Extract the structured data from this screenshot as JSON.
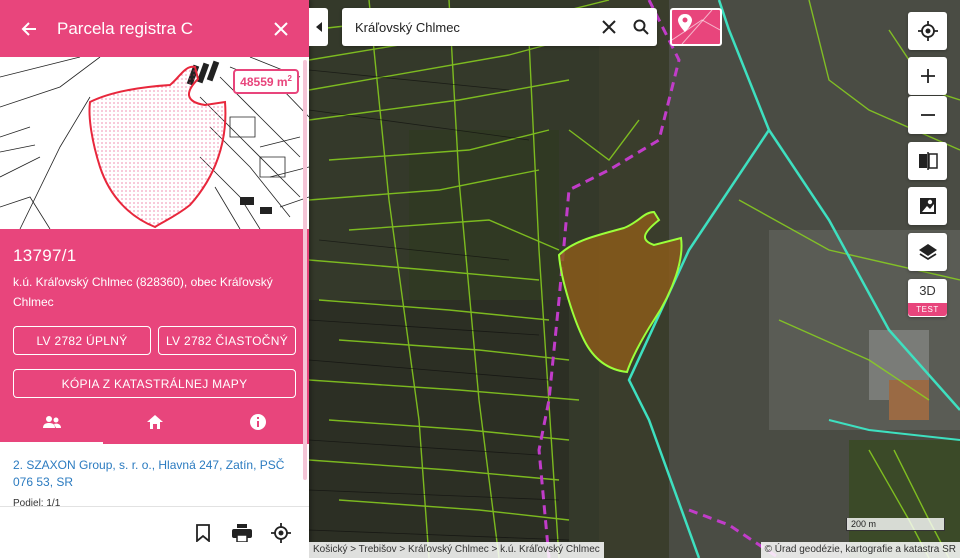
{
  "panel": {
    "title": "Parcela registra C",
    "area_value": "48559 m",
    "area_unit_sup": "2",
    "parcel_number": "13797/1",
    "parcel_desc": "k.ú. Kráľovský Chlmec (828360), obec Kráľovský Chlmec",
    "buttons": {
      "lv_full": "LV 2782 ÚPLNÝ",
      "lv_partial": "LV 2782 ČIASTOČNÝ",
      "map_copy": "KÓPIA Z KATASTRÁLNEJ MAPY"
    },
    "tabs": [
      {
        "icon": "people-icon"
      },
      {
        "icon": "home-icon"
      },
      {
        "icon": "info-icon"
      }
    ],
    "owner": {
      "link": "2. SZAXON Group, s. r. o., Hlavná 247, Zatín, PSČ 076 53, SR",
      "share": "Podiel: 1/1"
    },
    "footer_icons": [
      "bookmark-icon",
      "print-icon",
      "locate-parcel-icon"
    ]
  },
  "search": {
    "value": "Kráľovský Chlmec"
  },
  "map": {
    "controls": [
      "my-location-icon",
      "zoom-in-icon",
      "zoom-out-icon",
      "compare-icon",
      "photo-map-icon",
      "layers-icon"
    ],
    "label_3d": "3D",
    "test_badge": "TEST",
    "scale_label": "200 m",
    "breadcrumb": "Košický > Trebišov > Kráľovský Chlmec > k.ú. Kráľovský Chlmec",
    "attribution": "© Úrad geodézie, kartografie a katastra SR"
  },
  "colors": {
    "accent": "#e8457c",
    "parcel_fill": "#8a5a1a",
    "parcel_outline": "#9bff3a",
    "boundary_cyan": "#3ee0c0",
    "boundary_magenta": "#c13cc9"
  }
}
